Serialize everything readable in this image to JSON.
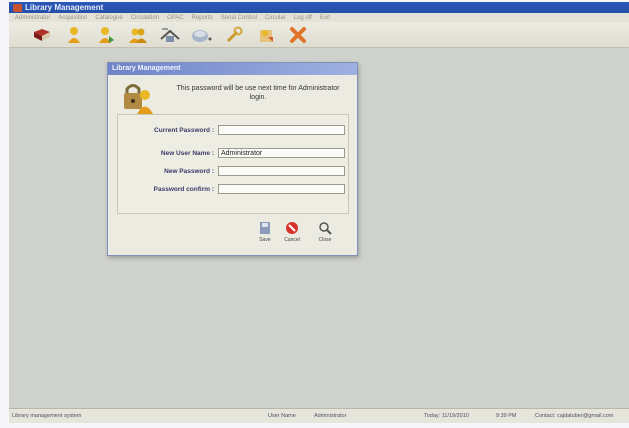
{
  "app": {
    "title": "Library Management",
    "menu": [
      "Administrator",
      "Acquisition",
      "Catalogue",
      "Circulation",
      "OPAC",
      "Reports",
      "Serial Control",
      "Circular",
      "Log off",
      "Exit"
    ]
  },
  "toolbar": {
    "icons": [
      "book-icon",
      "member-icon",
      "issue-icon",
      "return-icon",
      "catalog-icon",
      "search-icon",
      "settings-icon",
      "report-icon",
      "exit-icon"
    ]
  },
  "dialog": {
    "title": "Library Management",
    "message": "This password will be use next time for Administrator login.",
    "fields": {
      "current_password": {
        "label": "Current Password :",
        "value": ""
      },
      "new_user_name": {
        "label": "New User Name :",
        "value": "Administrator"
      },
      "new_password": {
        "label": "New Password :",
        "value": ""
      },
      "password_confirm": {
        "label": "Password confirm :",
        "value": ""
      }
    },
    "buttons": {
      "save": "Save",
      "cancel": "Cancel",
      "close": "Close"
    }
  },
  "statusbar": {
    "left": "Library management system",
    "user_label": "User Name",
    "user_value": "Administrator",
    "date": "Today: 11/19/2010",
    "time": "9:39 PM",
    "contact": "Contact: cajdatuber@gmail.com"
  }
}
